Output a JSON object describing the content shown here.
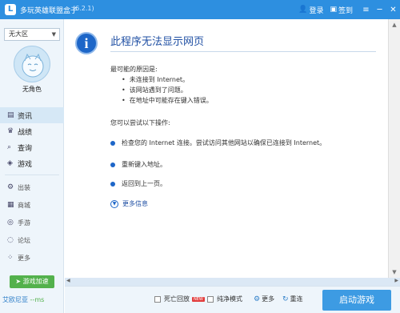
{
  "window": {
    "title": "多玩英雄联盟盒子",
    "version": "(6.2.1)",
    "login_label": "登录",
    "signin_label": "签到",
    "icons": [
      "user-icon",
      "calendar-icon",
      "menu-icon",
      "minimize-icon",
      "close-icon"
    ]
  },
  "sidebar": {
    "server_select": "无大区",
    "avatar_name": "无角色",
    "nav_main": [
      {
        "label": "资讯",
        "icon": "info-icon"
      },
      {
        "label": "战绩",
        "icon": "trophy-icon"
      },
      {
        "label": "查询",
        "icon": "search-icon"
      },
      {
        "label": "游戏",
        "icon": "gamepad-icon"
      }
    ],
    "nav_sub": [
      {
        "label": "出装",
        "icon": "gear-icon"
      },
      {
        "label": "商城",
        "icon": "shop-icon"
      },
      {
        "label": "手游",
        "icon": "phone-icon"
      },
      {
        "label": "论坛",
        "icon": "forum-icon"
      },
      {
        "label": "更多",
        "icon": "grid-icon"
      }
    ],
    "speed_button": "游戏加速",
    "status_name": "艾欧尼亚",
    "status_ms": "--ms"
  },
  "error_page": {
    "title": "此程序无法显示网页",
    "causes_heading": "最可能的原因是:",
    "causes": [
      "未连接到 Internet。",
      "该网站遇到了问题。",
      "在地址中可能存在键入错误。"
    ],
    "actions_heading": "您可以尝试以下操作:",
    "actions": [
      "检查您的 Internet 连接。尝试访问其他网站以确保已连接到 Internet。",
      "重新键入地址。",
      "返回到上一页。"
    ],
    "more_info": "更多信息"
  },
  "bottom_bar": {
    "replay_label": "死亡回放",
    "new_badge": "NEW",
    "pure_mode_label": "纯净模式",
    "more_label": "更多",
    "reconnect_label": "重连",
    "launch_label": "启动游戏"
  },
  "colors": {
    "accent": "#2d8fe0",
    "launch": "#3d9be3",
    "speed": "#53b14c"
  }
}
